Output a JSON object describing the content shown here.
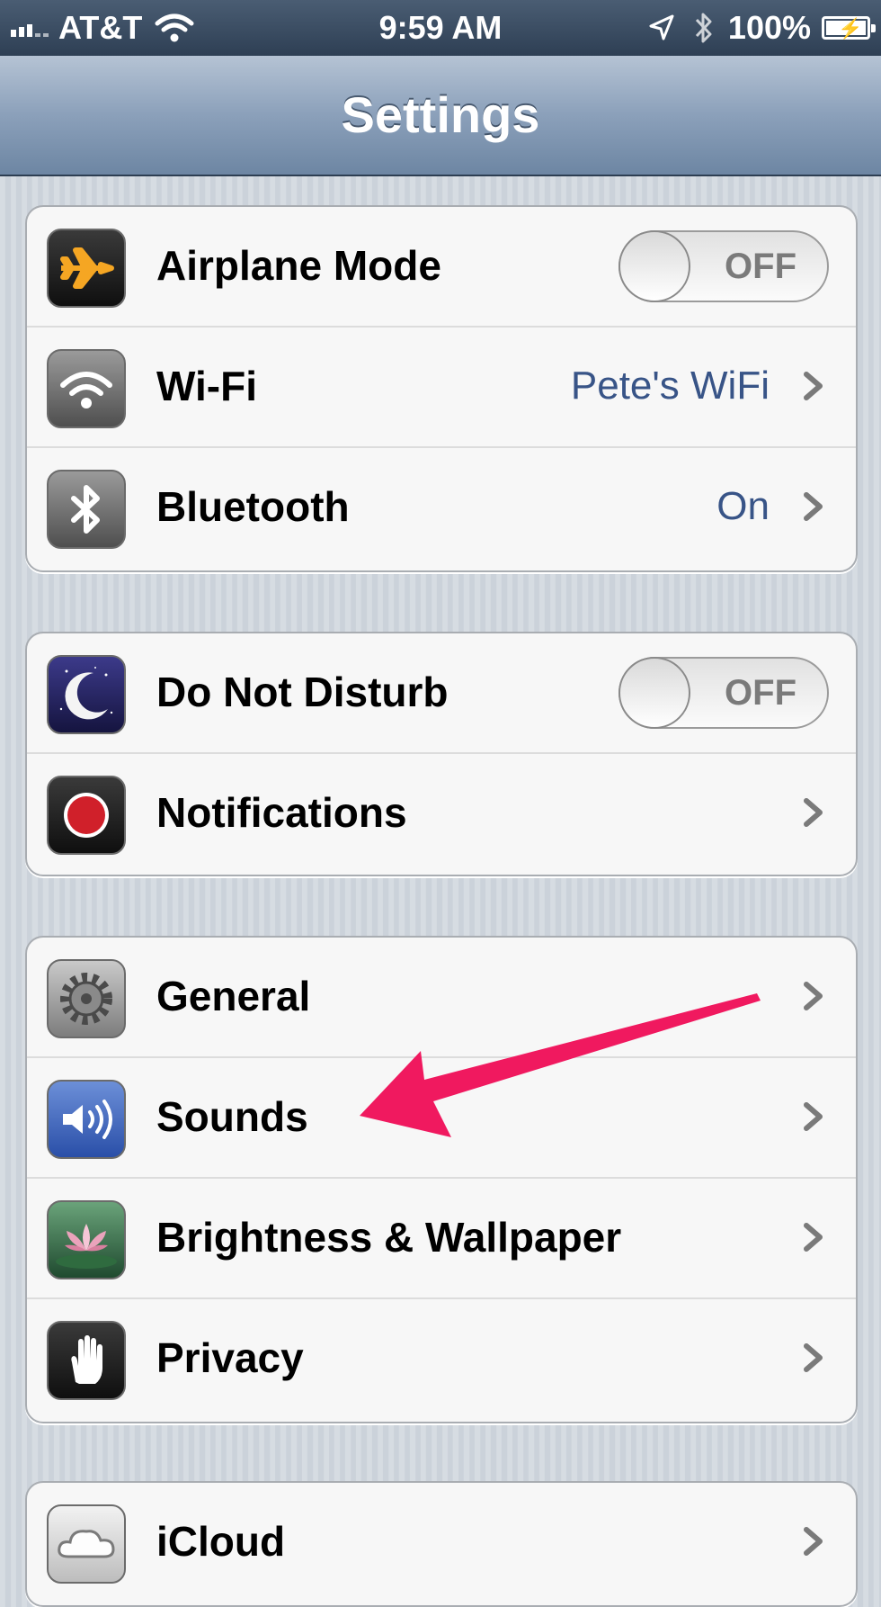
{
  "status_bar": {
    "carrier": "AT&T",
    "time": "9:59 AM",
    "battery": "100%",
    "battery_level": 1.0,
    "icons": [
      "signal-icon",
      "wifi-icon",
      "location-icon",
      "bluetooth-icon",
      "battery-icon"
    ]
  },
  "nav": {
    "title": "Settings"
  },
  "groups": [
    {
      "rows": [
        {
          "label": "Airplane Mode",
          "icon": "airplane-icon",
          "toggle": "OFF"
        },
        {
          "label": "Wi-Fi",
          "icon": "wifi-icon",
          "value": "Pete's WiFi"
        },
        {
          "label": "Bluetooth",
          "icon": "bluetooth-icon",
          "value": "On"
        }
      ]
    },
    {
      "rows": [
        {
          "label": "Do Not Disturb",
          "icon": "moon-icon",
          "toggle": "OFF"
        },
        {
          "label": "Notifications",
          "icon": "notifications-icon"
        }
      ]
    },
    {
      "rows": [
        {
          "label": "General",
          "icon": "gear-icon"
        },
        {
          "label": "Sounds",
          "icon": "speaker-icon"
        },
        {
          "label": "Brightness & Wallpaper",
          "icon": "flower-icon"
        },
        {
          "label": "Privacy",
          "icon": "hand-icon"
        }
      ]
    },
    {
      "rows": [
        {
          "label": "iCloud",
          "icon": "cloud-icon"
        }
      ]
    }
  ],
  "annotation": {
    "color": "#f0195f",
    "points_to": "Sounds"
  },
  "colors": {
    "value_text": "#385487",
    "nav_top": "#b5c3d4",
    "nav_bottom": "#6d86a3"
  }
}
